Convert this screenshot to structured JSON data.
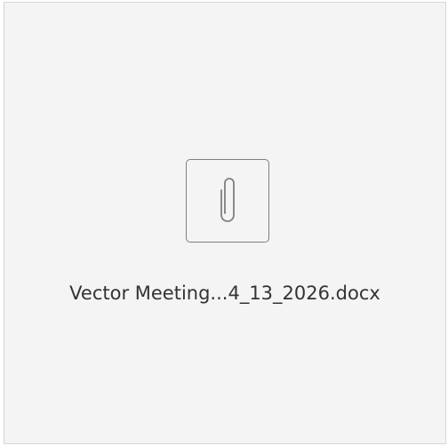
{
  "attachment": {
    "icon": "paperclip-icon",
    "file_name": "Vector Meeting...4_13_2026.docx"
  },
  "colors": {
    "card_background": "#f4f4f4",
    "card_border": "#d6d6d6",
    "icon_stroke": "#7f7f7f",
    "text": "#333333"
  }
}
